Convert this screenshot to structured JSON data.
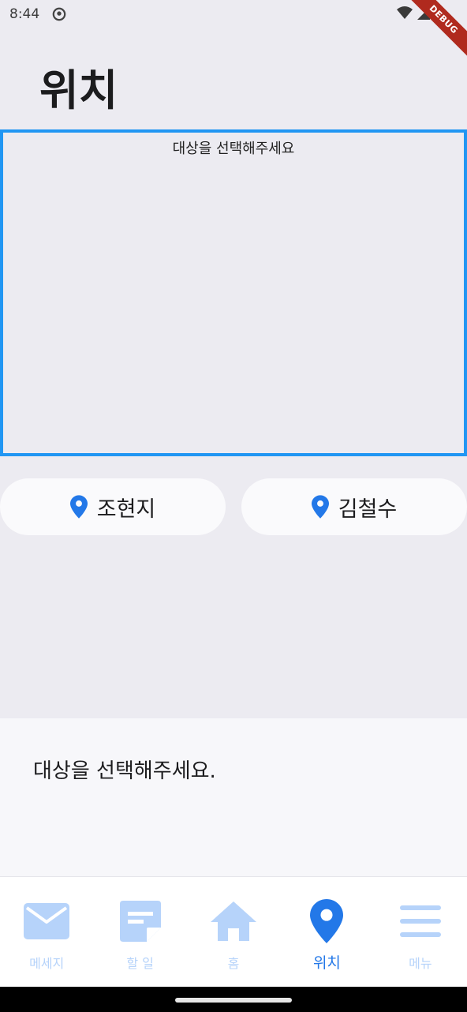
{
  "status_bar": {
    "time": "8:44",
    "debug_label": "DEBUG"
  },
  "header": {
    "title": "위치"
  },
  "map": {
    "hint": "대상을 선택해주세요",
    "border_color": "#2196F3"
  },
  "targets": [
    {
      "label": "조현지",
      "icon": "location-pin-icon"
    },
    {
      "label": "김철수",
      "icon": "location-pin-icon"
    }
  ],
  "info_panel": {
    "text": "대상을 선택해주세요."
  },
  "bottom_nav": {
    "items": [
      {
        "label": "메세지",
        "icon": "mail-icon",
        "active": false
      },
      {
        "label": "할 일",
        "icon": "note-icon",
        "active": false
      },
      {
        "label": "홈",
        "icon": "home-icon",
        "active": false
      },
      {
        "label": "위치",
        "icon": "location-pin-icon",
        "active": true
      },
      {
        "label": "메뉴",
        "icon": "menu-icon",
        "active": false
      }
    ],
    "active_color": "#2378E8",
    "inactive_color": "#B6D3FA"
  }
}
